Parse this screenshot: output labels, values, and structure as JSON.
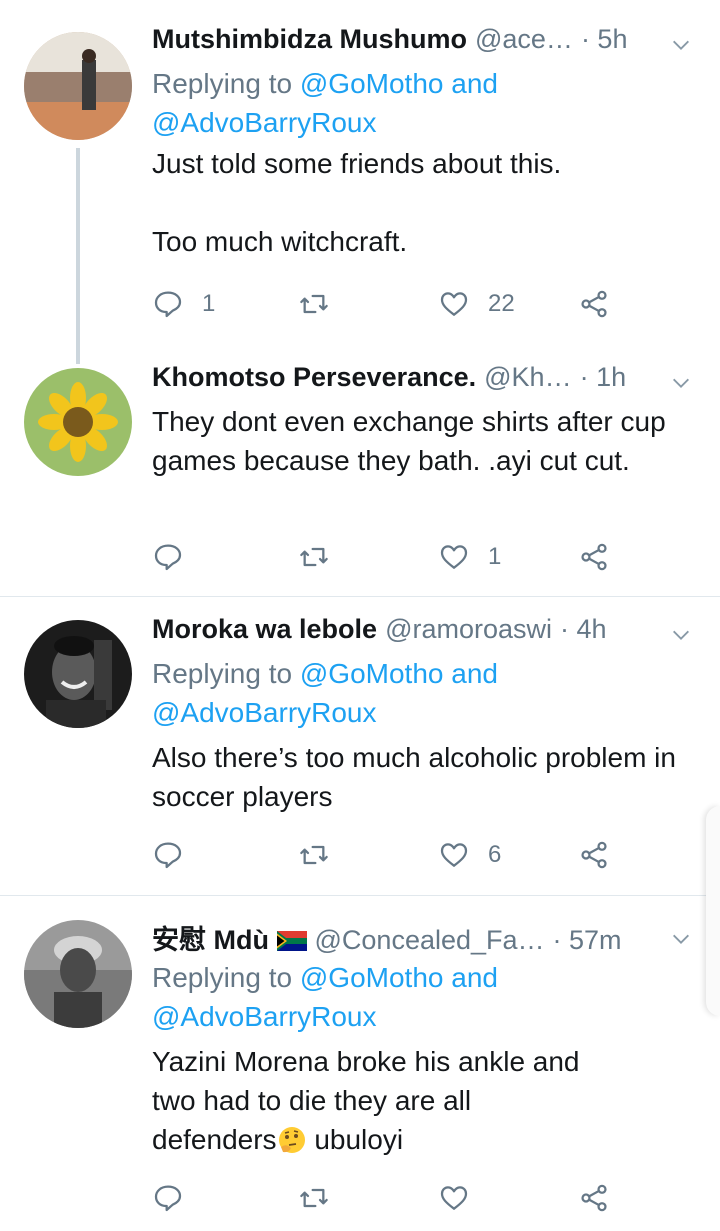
{
  "tweets": [
    {
      "name": "Mutshimbidza Mushumo",
      "handle": "@ace…",
      "time": "· 5h",
      "reply_prefix": "Replying to",
      "reply_mention_1": "@GoMotho and",
      "reply_mention_2": "@AdvoBarryRoux",
      "text": "Just told some friends about this.\n\nToo much witchcraft.",
      "replies": "1",
      "retweets": "",
      "likes": "22"
    },
    {
      "name": "Khomotso Perseverance.",
      "handle": "@Kh…",
      "time": "· 1h",
      "text": "They dont even exchange shirts after cup games because they bath. .ayi cut cut.",
      "replies": "",
      "retweets": "",
      "likes": "1"
    },
    {
      "name": "Moroka wa lebole",
      "handle": "@ramoroaswi",
      "time": "· 4h",
      "reply_prefix": "Replying to",
      "reply_mention_1": "@GoMotho and",
      "reply_mention_2": "@AdvoBarryRoux",
      "text": "Also there’s too much alcoholic problem in soccer players",
      "replies": "",
      "retweets": "",
      "likes": "6"
    },
    {
      "name": "安慰 Mdù",
      "handle": "@Concealed_Fa…",
      "time": "· 57m",
      "reply_prefix": "Replying to",
      "reply_mention_1": "@GoMotho and",
      "reply_mention_2": "@AdvoBarryRoux",
      "text_line1": "Yazini Morena broke his ankle and",
      "text_line2": "two had to die they are all",
      "text_line3_a": "defenders",
      "text_line3_b": " ubuloyi",
      "replies": "",
      "retweets": "",
      "likes": ""
    }
  ],
  "icons": {
    "reply": "reply-icon",
    "retweet": "retweet-icon",
    "like": "heart-icon",
    "share": "share-icon",
    "menu": "chevron-down-icon",
    "emoji": "thinking-face-emoji",
    "flag": "south-africa-flag"
  },
  "colors": {
    "link": "#1da1f2",
    "secondary": "#657786",
    "text": "#14171a",
    "divider": "#e1e8ed"
  }
}
